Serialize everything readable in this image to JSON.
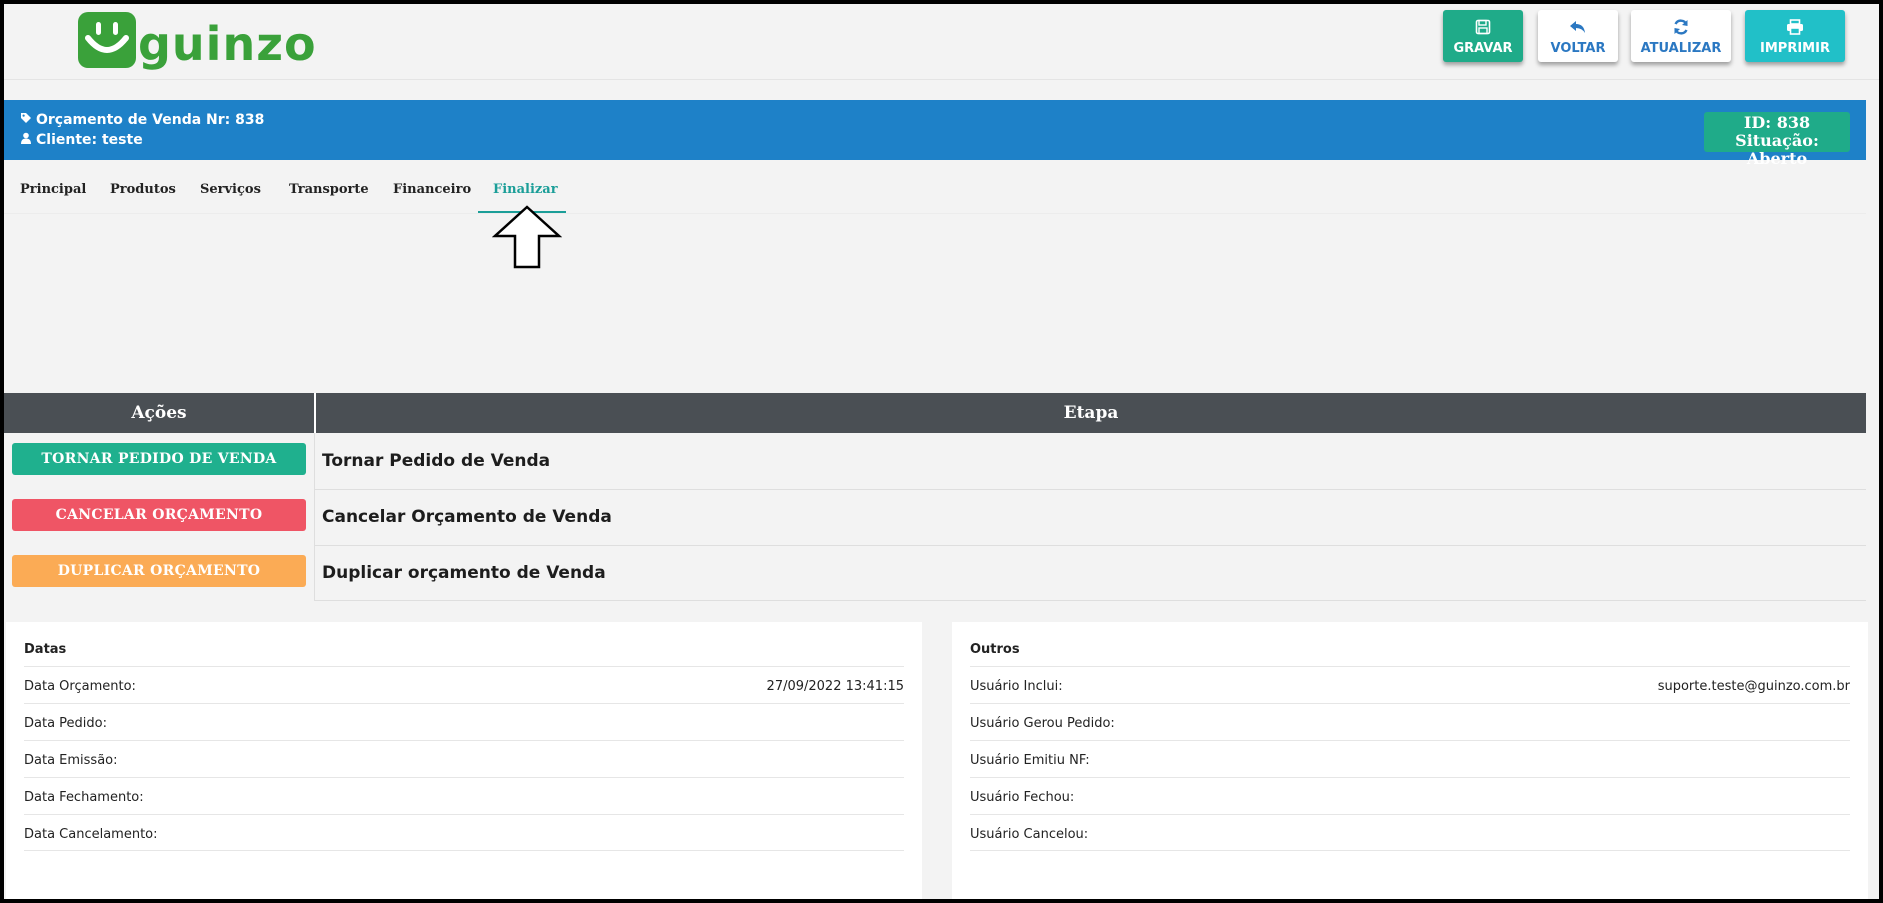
{
  "header": {
    "logo_text": "guinzo",
    "buttons": {
      "gravar": "GRAVAR",
      "voltar": "VOLTAR",
      "atualizar": "ATUALIZAR",
      "imprimir": "IMPRIMIR"
    }
  },
  "info": {
    "orcamento": "Orçamento de Venda Nr: 838",
    "cliente": "Cliente: teste",
    "id": "ID: 838",
    "situacao": "Situação: Aberto"
  },
  "tabs": [
    "Principal",
    "Produtos",
    "Serviços",
    "Transporte",
    "Financeiro",
    "Finalizar"
  ],
  "active_tab": "Finalizar",
  "actions": {
    "header_acoes": "Ações",
    "header_etapa": "Etapa",
    "rows": [
      {
        "button": "TORNAR PEDIDO DE VENDA",
        "etapa": "Tornar Pedido de Venda"
      },
      {
        "button": "CANCELAR ORÇAMENTO",
        "etapa": "Cancelar Orçamento de Venda"
      },
      {
        "button": "DUPLICAR ORÇAMENTO",
        "etapa": "Duplicar orçamento de Venda"
      }
    ]
  },
  "datas": {
    "title": "Datas",
    "rows": [
      {
        "label": "Data Orçamento:",
        "value": "27/09/2022 13:41:15"
      },
      {
        "label": "Data Pedido:",
        "value": ""
      },
      {
        "label": "Data Emissão:",
        "value": ""
      },
      {
        "label": "Data Fechamento:",
        "value": ""
      },
      {
        "label": "Data Cancelamento:",
        "value": ""
      }
    ]
  },
  "outros": {
    "title": "Outros",
    "rows": [
      {
        "label": "Usuário Inclui:",
        "value": "suporte.teste@guinzo.com.br"
      },
      {
        "label": "Usuário Gerou Pedido:",
        "value": ""
      },
      {
        "label": "Usuário Emitiu NF:",
        "value": ""
      },
      {
        "label": "Usuário Fechou:",
        "value": ""
      },
      {
        "label": "Usuário Cancelou:",
        "value": ""
      }
    ]
  },
  "colors": {
    "brand_green": "#3aa13a",
    "info_blue": "#1e81c8",
    "teal": "#1fab89",
    "danger": "#ef5565",
    "warning": "#fbab55"
  },
  "icons": [
    "save-icon",
    "undo-icon",
    "refresh-icon",
    "print-icon",
    "tag-icon",
    "user-icon",
    "arrow-up-icon"
  ]
}
